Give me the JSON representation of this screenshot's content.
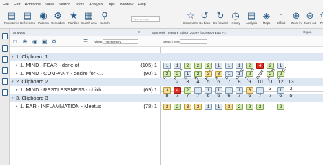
{
  "menu": [
    "File",
    "Edit",
    "Additions",
    "View",
    "Search",
    "Tools",
    "Analysis",
    "Tips",
    "Window",
    "Help"
  ],
  "toolbar": {
    "buttons": [
      {
        "label": "Repertories",
        "icon": "repertory-icon"
      },
      {
        "label": "References",
        "icon": "references-icon"
      },
      {
        "label": "Patients",
        "icon": "patients-icon"
      },
      {
        "label": "Remedies",
        "icon": "remedies-icon"
      },
      {
        "label": "Families",
        "icon": "families-icon"
      },
      {
        "label": "Search area",
        "icon": "search-area-icon"
      },
      {
        "label": "Search",
        "icon": "search-icon"
      },
      {
        "label": "Bookmarks",
        "icon": "star-icon"
      },
      {
        "label": "Go back",
        "icon": "back-icon"
      },
      {
        "label": "Go forward",
        "icon": "forward-icon"
      },
      {
        "label": "History",
        "icon": "history-icon"
      },
      {
        "label": "Analysis",
        "icon": "analysis-icon"
      },
      {
        "label": "Maps",
        "icon": "maps-icon"
      },
      {
        "label": "Clifical",
        "icon": "clinical-icon"
      },
      {
        "label": "Zoom in",
        "icon": "zoom-in-icon"
      },
      {
        "label": "Zoom out",
        "icon": "zoom-out-icon"
      },
      {
        "label": "Print",
        "icon": "print-icon"
      },
      {
        "label": "Sc",
        "icon": "screen-icon"
      }
    ],
    "search_placeholder": "Type to begin"
  },
  "analysis": {
    "title": "Analysis",
    "close": "x",
    "synthesis_title": "Synthesis Treasure Edition 2009V (SCHROYENS F.)",
    "views_label": "Views:",
    "views_value": "Full repertory",
    "search_remedy_label": "Search remedy:",
    "organon_tab": "Organ"
  },
  "rubric_rows": [
    {
      "type": "clip",
      "text": "1. Clipboard 1",
      "count": ""
    },
    {
      "type": "rub",
      "text": "1. MIND - FEAR - dark; of",
      "count": "(105) 1"
    },
    {
      "type": "rub",
      "text": "1. MIND - COMPANY - desire for -...",
      "count": "(90) 1"
    },
    {
      "type": "clip",
      "text": "2. Clipboard 2",
      "count": ""
    },
    {
      "type": "rub",
      "text": "1. MIND - RESTLESSNESS - childr...",
      "count": "(69) 1"
    },
    {
      "type": "clip",
      "text": "3. Clipboard 3",
      "count": ""
    },
    {
      "type": "rub",
      "text": "1. EAR - INFLAMMATION - Meatus",
      "count": "(78) 1"
    }
  ],
  "remedies": [
    "merc.",
    "rhus-t.",
    "calc.",
    "lyc.",
    "phos.",
    "ars.",
    "bell.",
    "caust.",
    "kali-c.",
    "acon.",
    "stram.",
    "camph"
  ],
  "rank": [
    "1",
    "2",
    "3",
    "4",
    "5",
    "6",
    "7",
    "8",
    "9",
    "10",
    "11",
    "12",
    "13"
  ],
  "sum_a": [
    "4",
    "4",
    "4",
    "4",
    "4",
    "4",
    "4",
    "4",
    "4",
    "4",
    "3",
    "3",
    "3"
  ],
  "sum_b": [
    "8",
    "7",
    "7",
    "7",
    "6",
    "6",
    "6",
    "7",
    "6",
    "7",
    "7",
    "6",
    "5"
  ],
  "grid": [
    [],
    [
      "1",
      "1",
      "2",
      "2",
      "2",
      "1",
      "1",
      "1",
      "2",
      "4",
      "2",
      "1"
    ],
    [
      "2",
      "2",
      "1",
      "2",
      "3",
      "3",
      "1",
      "1",
      "2",
      "",
      "2",
      "2"
    ],
    [],
    [
      "3",
      "4",
      "2",
      "1",
      "1",
      "1",
      "1",
      "1",
      "3",
      "1",
      "",
      "1"
    ],
    [],
    [
      "3",
      "2",
      "3",
      "3",
      "1",
      "1",
      "3",
      "2",
      "2",
      "2",
      "",
      "2"
    ]
  ]
}
